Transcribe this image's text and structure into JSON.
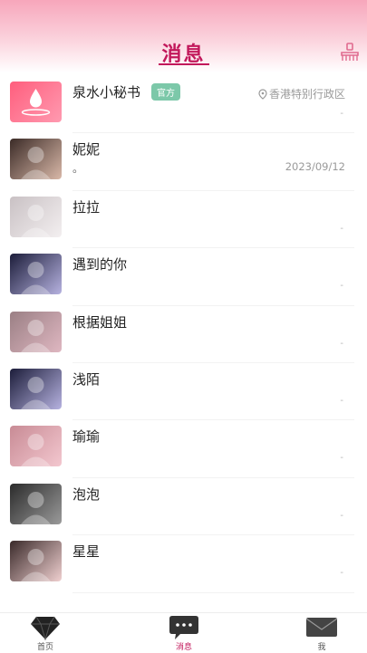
{
  "header": {
    "title": "消息",
    "clear_icon": "broom-icon"
  },
  "conversations": [
    {
      "name": "泉水小秘书",
      "badge": "官方",
      "location": "香港特别行政区",
      "preview": "",
      "time": "",
      "tick": "-",
      "avatar_colors": [
        "#ff5e7d",
        "#ff9ab0"
      ]
    },
    {
      "name": "妮妮",
      "badge": "",
      "location": "",
      "preview": "。",
      "time": "2023/09/12",
      "tick": "",
      "avatar_colors": [
        "#3b2b27",
        "#d9b8a8"
      ]
    },
    {
      "name": "拉拉",
      "badge": "",
      "location": "",
      "preview": "",
      "time": "",
      "tick": "-",
      "avatar_colors": [
        "#c9c1c4",
        "#f3eff0"
      ]
    },
    {
      "name": "遇到的你",
      "badge": "",
      "location": "",
      "preview": "",
      "time": "",
      "tick": "-",
      "avatar_colors": [
        "#1c1d3a",
        "#b6b2e0"
      ]
    },
    {
      "name": "根据姐姐",
      "badge": "",
      "location": "",
      "preview": "",
      "time": "",
      "tick": "-",
      "avatar_colors": [
        "#9a7f84",
        "#dfb7c1"
      ]
    },
    {
      "name": "浅陌",
      "badge": "",
      "location": "",
      "preview": "",
      "time": "",
      "tick": "-",
      "avatar_colors": [
        "#1c1d3a",
        "#b6b2e0"
      ]
    },
    {
      "name": "瑜瑜",
      "badge": "",
      "location": "",
      "preview": "",
      "time": "",
      "tick": "-",
      "avatar_colors": [
        "#c88b95",
        "#f3c7cf"
      ]
    },
    {
      "name": "泡泡",
      "badge": "",
      "location": "",
      "preview": "",
      "time": "",
      "tick": "-",
      "avatar_colors": [
        "#2b2b2b",
        "#9a9a9a"
      ]
    },
    {
      "name": "星星",
      "badge": "",
      "location": "",
      "preview": "",
      "time": "",
      "tick": "-",
      "avatar_colors": [
        "#3a2a2a",
        "#f0d0d0"
      ]
    }
  ],
  "tabbar": {
    "tabs": [
      {
        "label": "首页",
        "icon": "diamond-icon",
        "active": false
      },
      {
        "label": "消息",
        "icon": "chat-bubble-icon",
        "active": true
      },
      {
        "label": "我",
        "icon": "envelope-icon",
        "active": false
      }
    ]
  },
  "colors": {
    "accent": "#c2185b",
    "badge": "#7cc8a9",
    "header_gradient_top": "#f7a6bb"
  }
}
